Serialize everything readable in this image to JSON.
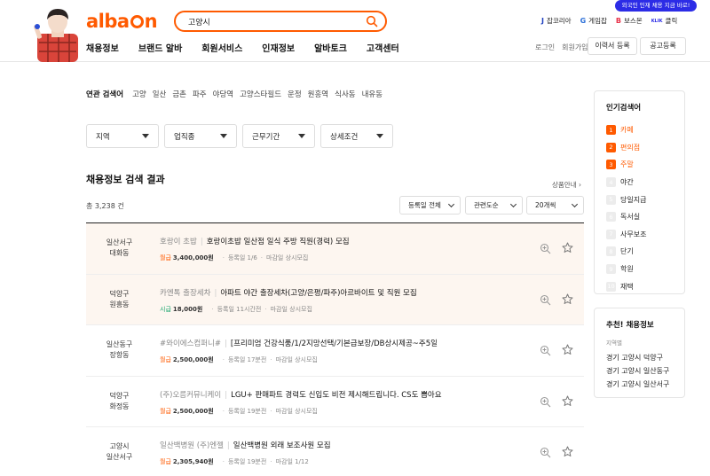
{
  "header": {
    "logo": "albamon",
    "search": {
      "value": "고양시"
    },
    "nav": [
      "채용정보",
      "브랜드 알바",
      "회원서비스",
      "인재정보",
      "알바토크",
      "고객센터"
    ],
    "promo": "외국인 인재 채용 지금 바로!",
    "family_sites": [
      {
        "icon": "J",
        "label": "잡코리아",
        "color": "#1f3fbf"
      },
      {
        "icon": "G",
        "label": "게임잡",
        "color": "#2b6fd8"
      },
      {
        "icon": "B",
        "label": "보스몬",
        "color": "#e8334a"
      },
      {
        "icon": "KLIK",
        "label": "클릭",
        "color": "#2c2ce6"
      }
    ],
    "login": "로그인",
    "signup": "회원가입",
    "resume_btn": "이력서 등록",
    "post_btn": "공고등록"
  },
  "related": {
    "label": "연관 검색어",
    "keywords": [
      "고양",
      "일산",
      "금촌",
      "파주",
      "야당역",
      "고양스타필드",
      "운정",
      "원흥역",
      "식사동",
      "내유동"
    ]
  },
  "filters": [
    "지역",
    "업직종",
    "근무기간",
    "상세조건"
  ],
  "results": {
    "title": "채용정보 검색 결과",
    "product_info": "상품안내",
    "total": "총 3,238 건",
    "sort": [
      "등록일 전체",
      "관련도순",
      "20개씩"
    ]
  },
  "jobs": [
    {
      "loc1": "일산서구",
      "loc2": "대화동",
      "company": "호랑이 초밥",
      "title": "호랑이초밥 일산점 일식 주방 직원(경력) 모집",
      "pay_type": "월급",
      "pay_type_color": "orange",
      "pay": "3,400,000원",
      "date": "등록일 1/6",
      "deadline": "마감일 상시모집",
      "highlight": true
    },
    {
      "loc1": "덕양구",
      "loc2": "원흥동",
      "company": "카엔톡 출장세차",
      "title": "아파트 야간 출장세차(고양/은평/파주)아르바이트 및 직원 모집",
      "pay_type": "시급",
      "pay_type_color": "green",
      "pay": "18,000원",
      "date": "등록일 11시간전",
      "deadline": "마감일 상시모집",
      "highlight": true
    },
    {
      "loc1": "일산동구",
      "loc2": "장항동",
      "company": "#와이에스컴퍼니#",
      "title": "[프리미엄 건강식품/1/2지망선택/기본급보장/DB상시제공~주5일",
      "pay_type": "월급",
      "pay_type_color": "orange",
      "pay": "2,500,000원",
      "date": "등록일 17분전",
      "deadline": "마감일 상시모집",
      "highlight": false
    },
    {
      "loc1": "덕양구",
      "loc2": "화정동",
      "company": "(주)오름커뮤니케이",
      "title": "LGU+ 판매파트 경력도 신입도 비전 제시해드립니다. CS도 뽑아요",
      "pay_type": "월급",
      "pay_type_color": "orange",
      "pay": "2,500,000원",
      "date": "등록일 19분전",
      "deadline": "마감일 상시모집",
      "highlight": false
    },
    {
      "loc1": "고양시",
      "loc2": "일산서구",
      "company": "일산백병원 (주)엔젤",
      "title": "일산백병원 외래 보조사원 모집",
      "pay_type": "월급",
      "pay_type_color": "orange",
      "pay": "2,305,940원",
      "date": "등록일 19분전",
      "deadline": "마감일 1/12",
      "highlight": false
    }
  ],
  "popular": {
    "title": "인기검색어",
    "items": [
      "카페",
      "편의점",
      "주말",
      "야간",
      "당일지급",
      "독서실",
      "사무보조",
      "단기",
      "학원",
      "재택"
    ]
  },
  "recommend": {
    "title": "추천! 채용정보",
    "sub": "지역별",
    "items": [
      "경기 고양시 덕양구",
      "경기 고양시 일산동구",
      "경기 고양시 일산서구"
    ]
  },
  "colors": {
    "accent": "#ff5a00",
    "green": "#13a36a",
    "highlight_row": "#fdf6f0"
  }
}
